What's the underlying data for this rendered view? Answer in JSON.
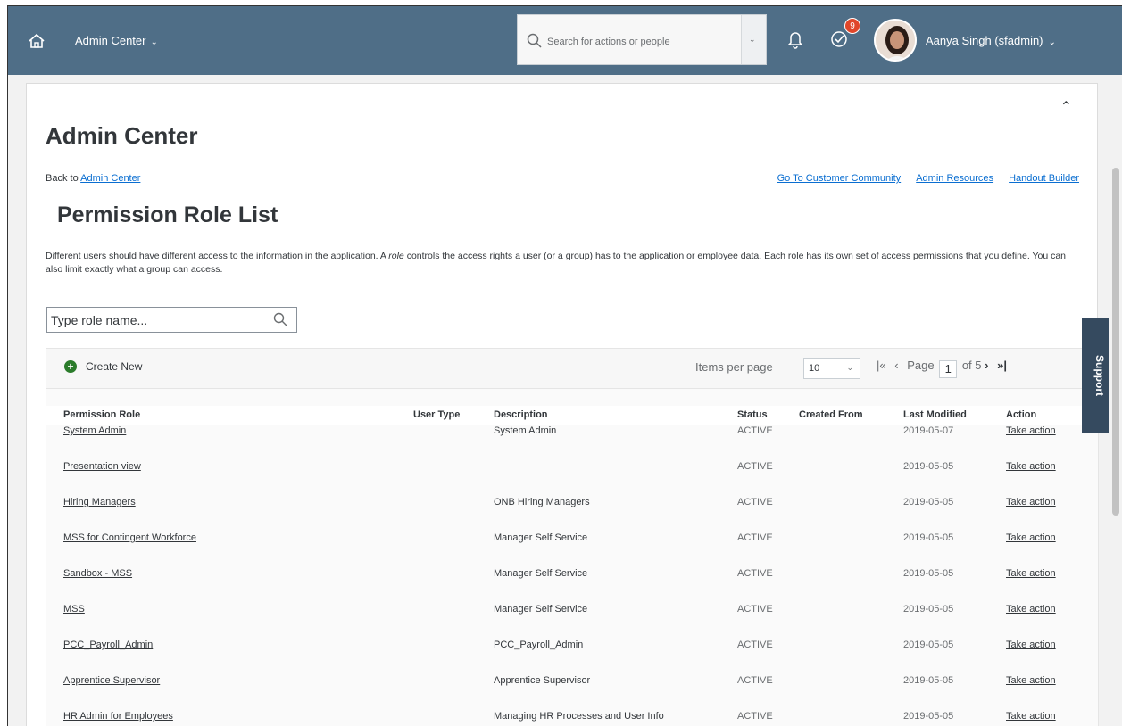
{
  "shell": {
    "title": "Admin Center",
    "search_placeholder": "Search for actions or people",
    "notification_count": "9",
    "user_name": "Aanya Singh (sfadmin)"
  },
  "header": {
    "title": "Admin Center",
    "back_prefix": "Back to ",
    "back_link": "Admin Center",
    "links": [
      "Go To Customer Community",
      "Admin Resources",
      "Handout Builder"
    ]
  },
  "page": {
    "title": "Permission Role List",
    "desc_1": "Different users should have different access to the information in the application. A ",
    "desc_role": "role",
    "desc_2": " controls the access rights a user (or a group) has to the application or employee data. Each role has its own set of access permissions that you define. You can also limit exactly what a group can access.",
    "search_placeholder": "Type role name..."
  },
  "toolbar": {
    "create_label": "Create New",
    "items_per_page_label": "Items per page",
    "items_per_page_value": "10",
    "page_label": "Page",
    "page_value": "1",
    "page_of": "of 5"
  },
  "table": {
    "columns": [
      "Permission Role",
      "User Type",
      "Description",
      "Status",
      "Created From",
      "Last Modified",
      "Action"
    ],
    "rows": [
      {
        "role": "System Admin",
        "description": "System Admin",
        "status": "ACTIVE",
        "modified": "2019-05-07",
        "action": "Take action"
      },
      {
        "role": "Presentation view",
        "description": "",
        "status": "ACTIVE",
        "modified": "2019-05-05",
        "action": "Take action"
      },
      {
        "role": "Hiring Managers",
        "description": "ONB Hiring Managers",
        "status": "ACTIVE",
        "modified": "2019-05-05",
        "action": "Take action"
      },
      {
        "role": "MSS for Contingent Workforce",
        "description": "Manager Self Service",
        "status": "ACTIVE",
        "modified": "2019-05-05",
        "action": "Take action"
      },
      {
        "role": "Sandbox - MSS",
        "description": "Manager Self Service",
        "status": "ACTIVE",
        "modified": "2019-05-05",
        "action": "Take action"
      },
      {
        "role": "MSS",
        "description": "Manager Self Service",
        "status": "ACTIVE",
        "modified": "2019-05-05",
        "action": "Take action"
      },
      {
        "role": "PCC_Payroll_Admin",
        "description": "PCC_Payroll_Admin",
        "status": "ACTIVE",
        "modified": "2019-05-05",
        "action": "Take action"
      },
      {
        "role": "Apprentice Supervisor",
        "description": "Apprentice Supervisor",
        "status": "ACTIVE",
        "modified": "2019-05-05",
        "action": "Take action"
      },
      {
        "role": "HR Admin for Employees",
        "description": "Managing HR Processes and User Info",
        "status": "ACTIVE",
        "modified": "2019-05-05",
        "action": "Take action"
      }
    ]
  },
  "support_label": "Support",
  "colors": {
    "shell": "#4f6e87",
    "link": "#0a6ed1",
    "support_tab": "#354a5f",
    "badge": "#e0462a",
    "create_icon": "#2b7c2b"
  },
  "icons": [
    "home-icon",
    "chevron-down-icon",
    "search-icon",
    "bell-icon",
    "tasks-check-icon",
    "chevron-up-icon",
    "add-icon",
    "first-page-icon",
    "previous-page-icon",
    "next-page-icon",
    "last-page-icon"
  ]
}
